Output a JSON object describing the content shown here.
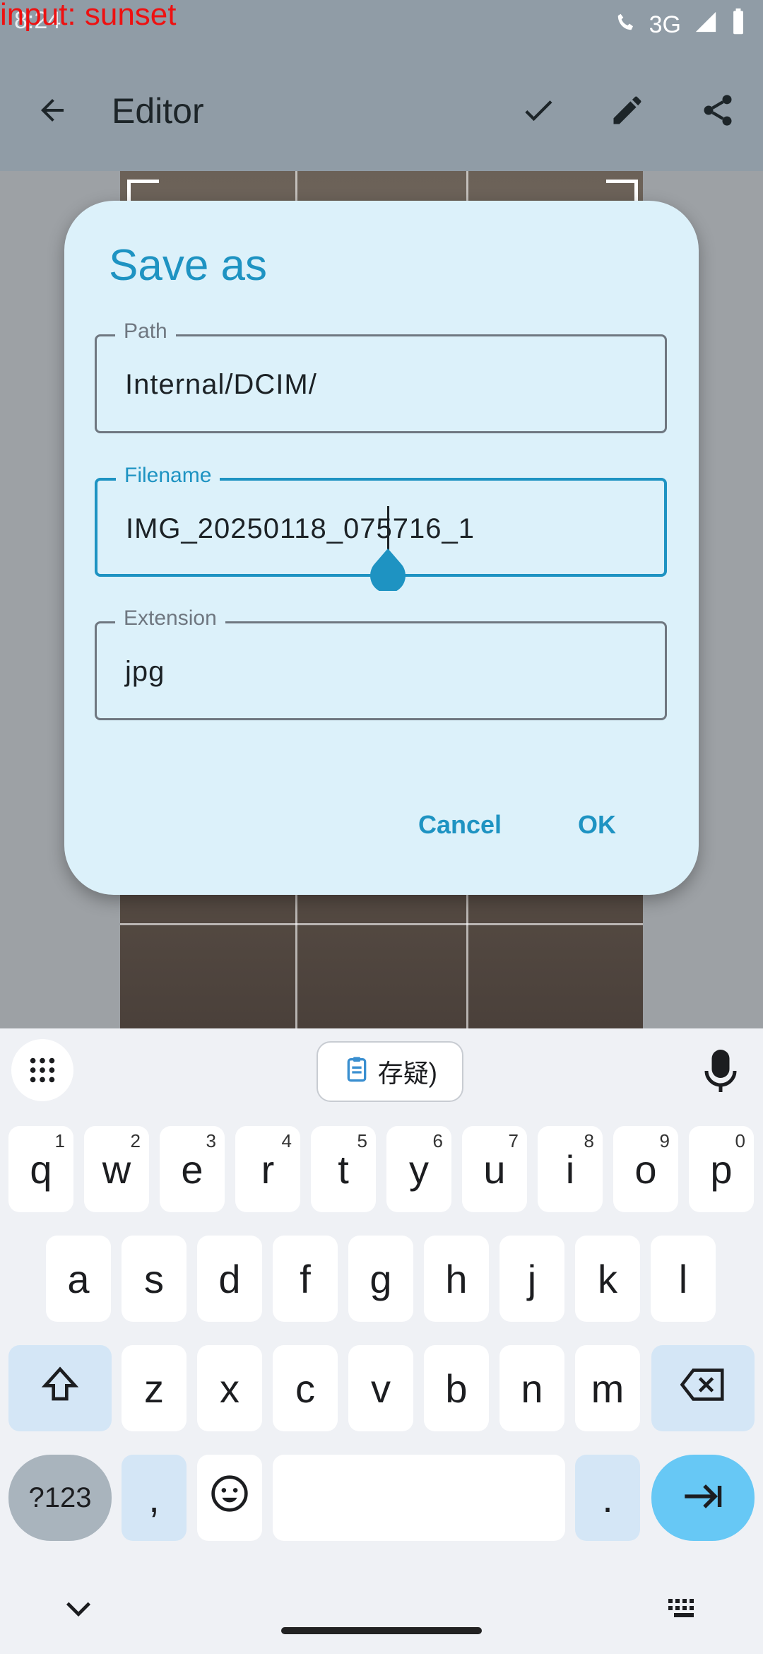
{
  "overlay": {
    "input_text": "input: sunset"
  },
  "status": {
    "time": "8:24",
    "network": "3G"
  },
  "appbar": {
    "title": "Editor"
  },
  "dialog": {
    "title": "Save as",
    "fields": [
      {
        "label": "Path",
        "value": "Internal/DCIM/"
      },
      {
        "label": "Filename",
        "value": "IMG_20250118_075716_1"
      },
      {
        "label": "Extension",
        "value": "jpg"
      }
    ],
    "cancel_label": "Cancel",
    "ok_label": "OK"
  },
  "keyboard": {
    "clipboard_chip": "存疑)",
    "row1": [
      [
        "q",
        "1"
      ],
      [
        "w",
        "2"
      ],
      [
        "e",
        "3"
      ],
      [
        "r",
        "4"
      ],
      [
        "t",
        "5"
      ],
      [
        "y",
        "6"
      ],
      [
        "u",
        "7"
      ],
      [
        "i",
        "8"
      ],
      [
        "o",
        "9"
      ],
      [
        "p",
        "0"
      ]
    ],
    "row2": [
      "a",
      "s",
      "d",
      "f",
      "g",
      "h",
      "j",
      "k",
      "l"
    ],
    "row3": [
      "z",
      "x",
      "c",
      "v",
      "b",
      "n",
      "m"
    ],
    "symbols_label": "?123",
    "comma": ",",
    "period": "."
  },
  "icons": [
    "back-arrow-icon",
    "check-icon",
    "pencil-icon",
    "share-icon",
    "grid-icon",
    "clipboard-icon",
    "mic-icon",
    "shift-icon",
    "backspace-icon",
    "emoji-icon",
    "enter-icon",
    "chevron-down-icon",
    "keyboard-icon"
  ]
}
